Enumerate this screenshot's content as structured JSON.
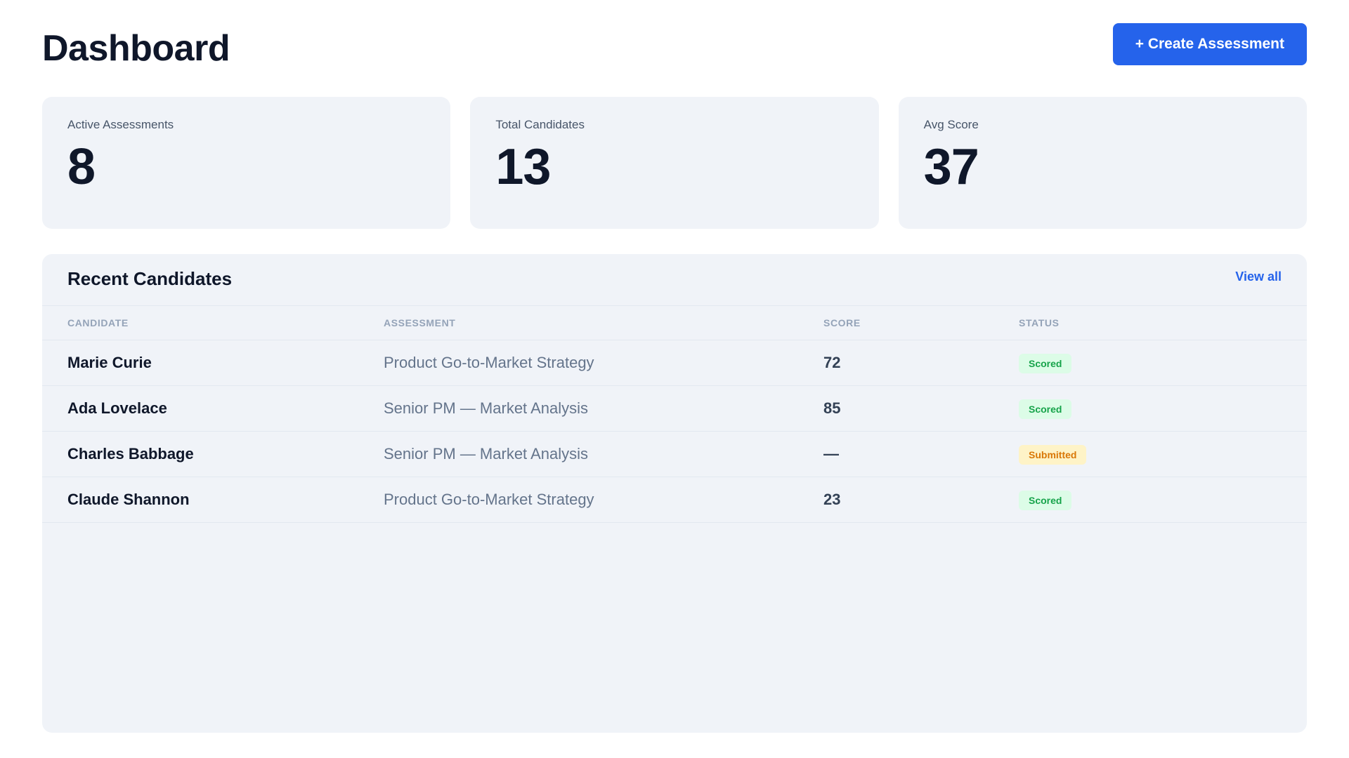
{
  "header": {
    "title": "Dashboard",
    "create_button_label": "+ Create Assessment"
  },
  "stats": [
    {
      "label": "Active Assessments",
      "value": "8"
    },
    {
      "label": "Total Candidates",
      "value": "13"
    },
    {
      "label": "Avg Score",
      "value": "37"
    }
  ],
  "recent": {
    "title": "Recent Candidates",
    "view_all_label": "View all",
    "columns": [
      "CANDIDATE",
      "ASSESSMENT",
      "SCORE",
      "STATUS"
    ],
    "rows": [
      {
        "candidate": "Marie Curie",
        "assessment": "Product Go-to-Market Strategy",
        "score": "72",
        "status": "Scored"
      },
      {
        "candidate": "Ada Lovelace",
        "assessment": "Senior PM — Market Analysis",
        "score": "85",
        "status": "Scored"
      },
      {
        "candidate": "Charles Babbage",
        "assessment": "Senior PM — Market Analysis",
        "score": "—",
        "status": "Submitted"
      },
      {
        "candidate": "Claude Shannon",
        "assessment": "Product Go-to-Market Strategy",
        "score": "23",
        "status": "Scored"
      }
    ]
  },
  "colors": {
    "accent": "#2563eb",
    "card_bg": "#f0f3f8",
    "scored_bg": "#dcfce7",
    "scored_text": "#16a34a",
    "submitted_bg": "#fef3c7",
    "submitted_text": "#d97706"
  }
}
